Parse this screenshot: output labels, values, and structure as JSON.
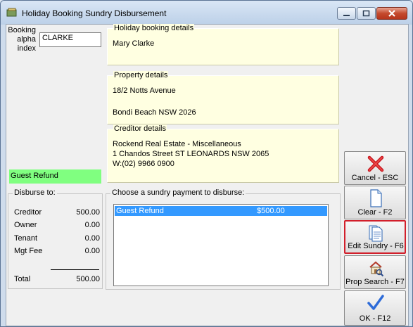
{
  "window": {
    "title": "Holiday Booking Sundry Disbursement"
  },
  "booking": {
    "label": [
      "Booking",
      "alpha",
      "index"
    ],
    "value": "CLARKE"
  },
  "holiday": {
    "legend": "Holiday booking details",
    "lines": [
      "Mary Clarke"
    ]
  },
  "property": {
    "legend": "Property details",
    "lines": [
      "18/2 Notts Avenue",
      "",
      "Bondi Beach  NSW  2026"
    ]
  },
  "creditor": {
    "legend": "Creditor details",
    "lines": [
      "Rockend Real Estate - Miscellaneous",
      "1 Chandos Street ST LEONARDS NSW 2065",
      "W:(02) 9966 0900"
    ]
  },
  "status": {
    "label": "Guest Refund",
    "color": "#80ff80"
  },
  "disburse": {
    "legend": "Disburse to:",
    "rows": [
      {
        "label": "Creditor",
        "value": "500.00"
      },
      {
        "label": "Owner",
        "value": "0.00"
      },
      {
        "label": "Tenant",
        "value": "0.00"
      },
      {
        "label": "Mgt Fee",
        "value": "0.00"
      }
    ],
    "total": {
      "label": "Total",
      "value": "500.00"
    }
  },
  "sundry": {
    "legend": "Choose a sundry payment to disburse:",
    "items": [
      {
        "description": "Guest Refund",
        "amount": "$500.00",
        "selected": true
      }
    ]
  },
  "buttons": [
    {
      "id": "cancel",
      "label": "Cancel - ESC",
      "icon": "red-x-icon"
    },
    {
      "id": "clear",
      "label": "Clear - F2",
      "icon": "blank-page-icon"
    },
    {
      "id": "edit",
      "label": "Edit Sundry - F6",
      "icon": "pages-icon",
      "highlighted": true
    },
    {
      "id": "propsearch",
      "label": "Prop Search - F7",
      "icon": "house-search-icon"
    },
    {
      "id": "ok",
      "label": "OK - F12",
      "icon": "checkmark-icon"
    }
  ],
  "colors": {
    "highlight": "#d21f2b",
    "selection": "#3399ff",
    "info_bg": "#ffffe1"
  }
}
